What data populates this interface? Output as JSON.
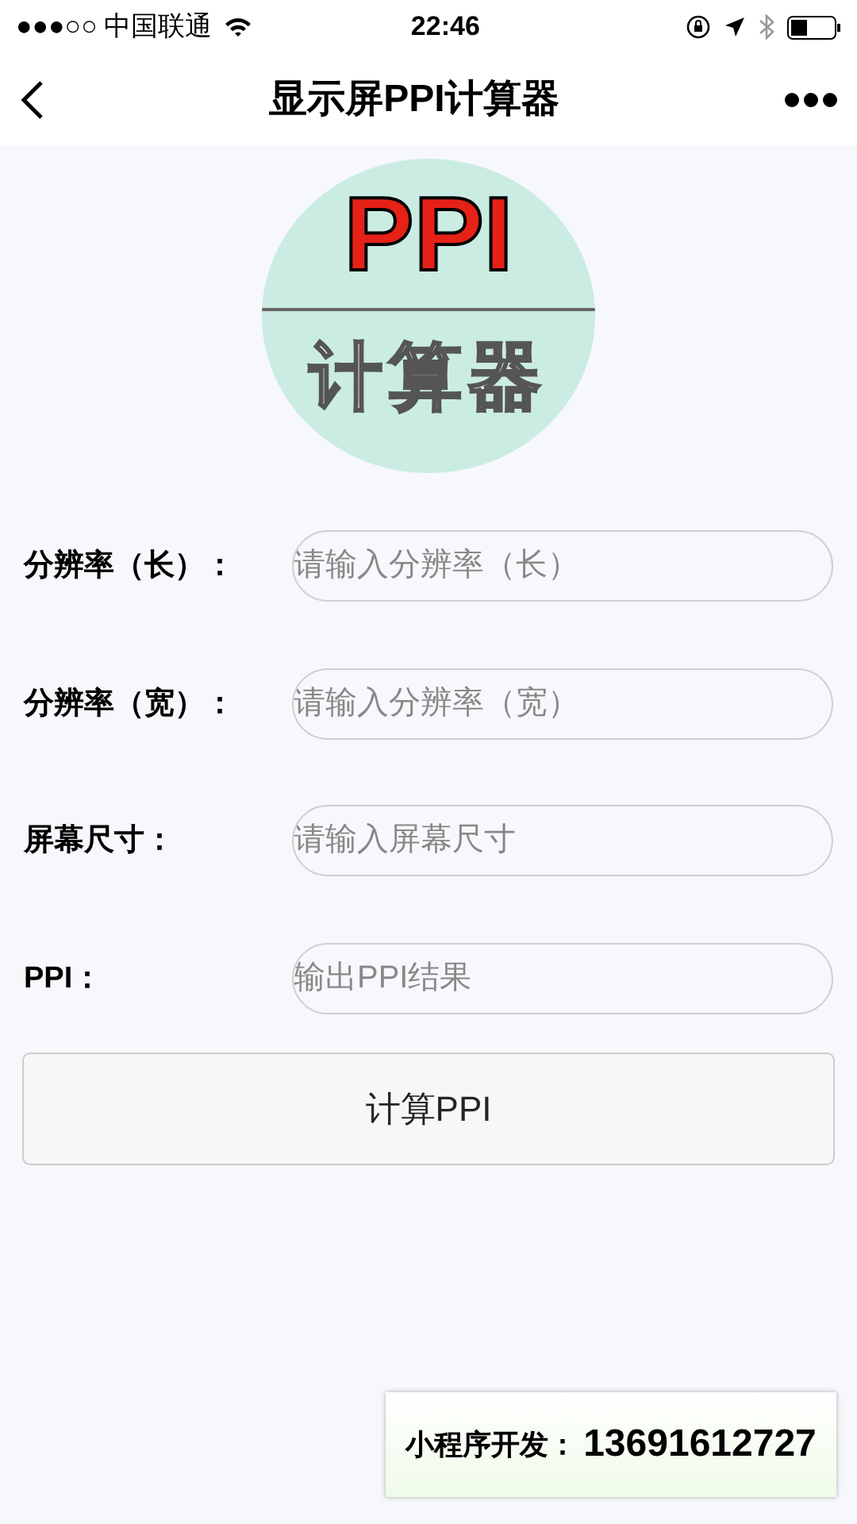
{
  "status_bar": {
    "signal_dots": "●●●○○",
    "carrier": "中国联通",
    "time": "22:46"
  },
  "nav": {
    "title": "显示屏PPI计算器"
  },
  "logo": {
    "top_text": "PPI",
    "bottom_text": "计算器"
  },
  "fields": [
    {
      "label": "分辨率（长）：",
      "placeholder": "请输入分辨率（长）"
    },
    {
      "label": "分辨率（宽）：",
      "placeholder": "请输入分辨率（宽）"
    },
    {
      "label": "屏幕尺寸：",
      "placeholder": "请输入屏幕尺寸"
    },
    {
      "label": "PPI：",
      "placeholder": "输出PPI结果"
    }
  ],
  "button": "计算PPI",
  "banner": {
    "label": "小程序开发：",
    "number": "13691612727"
  }
}
